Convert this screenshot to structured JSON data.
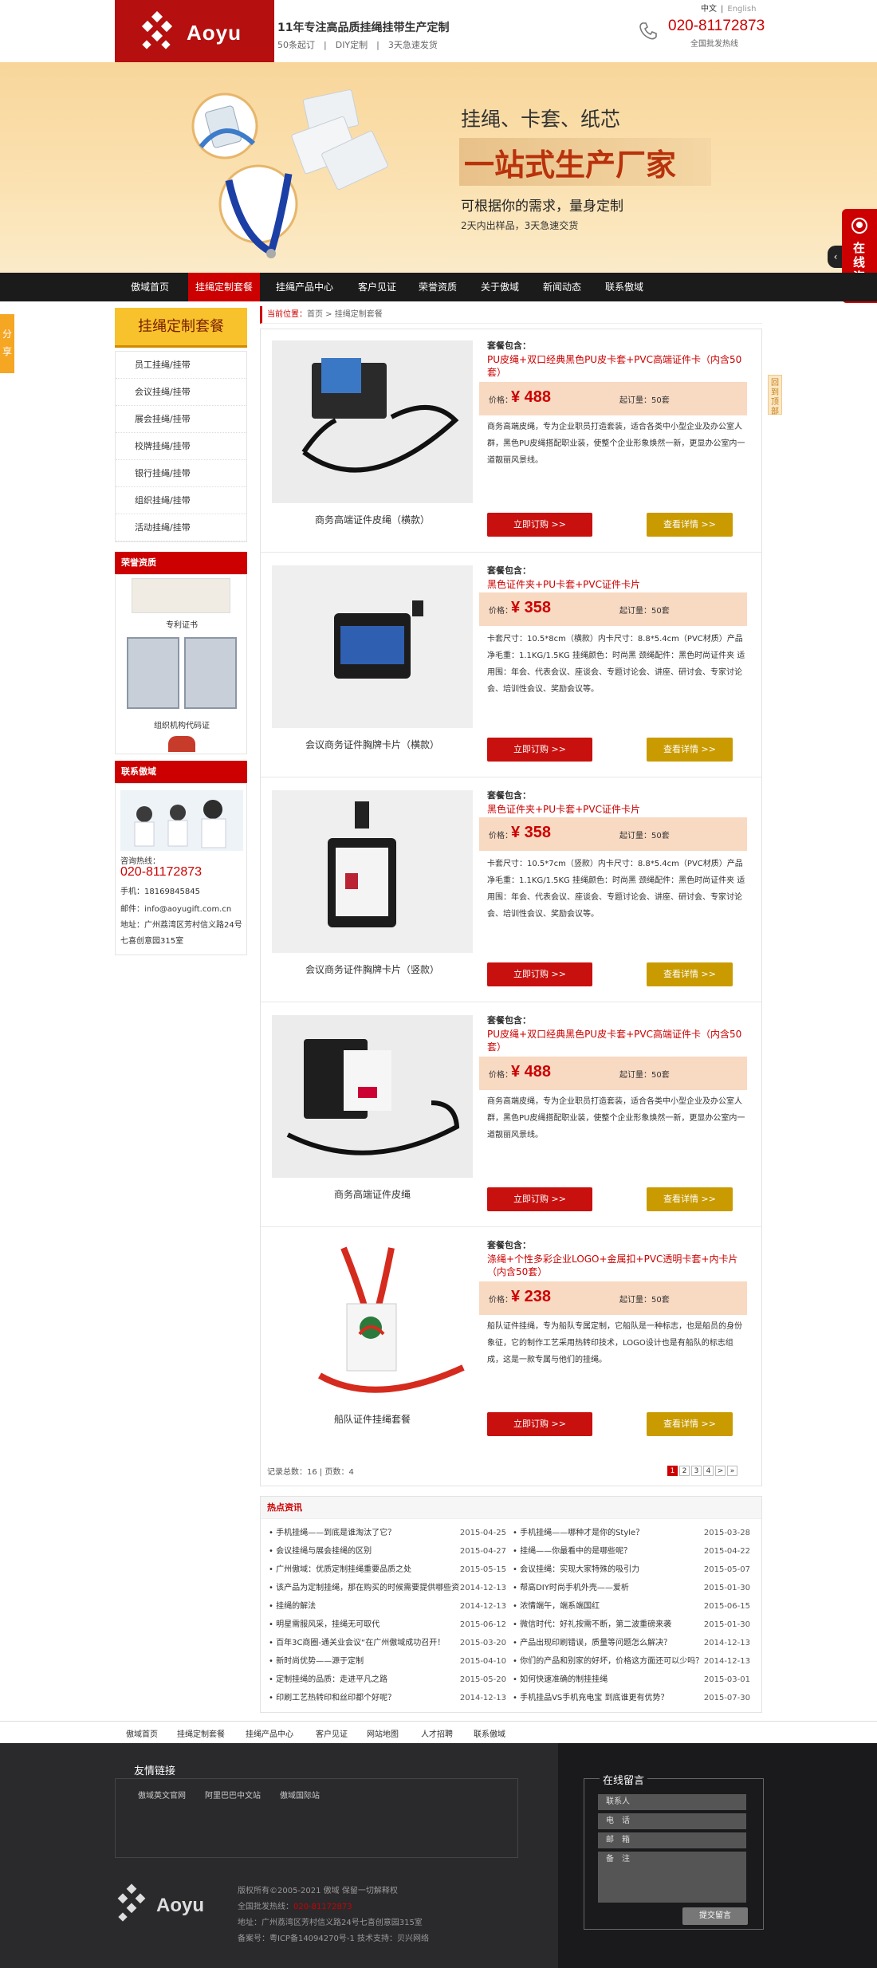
{
  "header": {
    "logo": "Aoyu",
    "slogan": "11年专注高品质挂绳挂带生产定制",
    "sub": [
      "50条起订",
      "DIY定制",
      "3天急速发货"
    ],
    "lang": [
      "中文",
      "English"
    ],
    "phone": "020-81172873",
    "phone_sub": "全国批发热线"
  },
  "banner": {
    "line1": "挂绳、卡套、纸芯",
    "line2": "一站式生产厂家",
    "line3": "可根据你的需求，量身定制",
    "line4": "2天内出样品，3天急速交货"
  },
  "nav": [
    "傲域首页",
    "挂绳定制套餐",
    "挂绳产品中心",
    "客户见证",
    "荣誉资质",
    "关于傲域",
    "新闻动态",
    "联系傲域"
  ],
  "consult": "在线咨询",
  "share": "分享",
  "backtop": "回到顶部",
  "sidebar": {
    "title": "挂绳定制套餐",
    "items": [
      "员工挂绳/挂带",
      "会议挂绳/挂带",
      "展会挂绳/挂带",
      "校牌挂绳/挂带",
      "银行挂绳/挂带",
      "组织挂绳/挂带",
      "活动挂绳/挂带"
    ],
    "honor_title": "荣誉资质",
    "honor": [
      "专利证书",
      "组织机构代码证"
    ],
    "contact_title": "联系傲域",
    "contact_label": "咨询热线：",
    "contact_phone": "020-81172873",
    "mobile": "手机：18169845845",
    "email": "邮件：info@aoyugift.com.cn",
    "addr": "地址：广州荔湾区芳村信义路24号七喜创意园315室"
  },
  "crumb": {
    "label": "当前位置：",
    "home": "首页",
    "sep": " > ",
    "page": "挂绳定制套餐"
  },
  "products": [
    {
      "pk": "套餐包含：",
      "title": "PU皮绳+双口经典黑色PU皮卡套+PVC高端证件卡（内含50套）",
      "price_label": "价格：",
      "price": "¥ 488",
      "order": "起订量：50套",
      "desc": "商务高端皮绳，专为企业职员打造套装，适合各类中小型企业及办公室人群，黑色PU皮绳搭配职业装，使整个企业形象焕然一新，更显办公室内一道靓丽风景线。",
      "name": "商务高端证件皮绳（横款）",
      "buy": "立即订购 >>",
      "detail": "查看详情 >>"
    },
    {
      "pk": "套餐包含：",
      "title": "黑色证件夹+PU卡套+PVC证件卡片",
      "price_label": "价格：",
      "price": "¥ 358",
      "order": "起订量：50套",
      "desc": "卡套尺寸：10.5*8cm（横款）内卡尺寸：8.8*5.4cm（PVC材质）产品净毛重：1.1KG/1.5KG 挂绳颜色：时尚黑 颈绳配件：黑色时尚证件夹 适用围：年会、代表会议、座谈会、专题讨论会、讲座、研讨会、专家讨论会、培训性会议、奖励会议等。",
      "name": "会议商务证件胸牌卡片（横款）",
      "buy": "立即订购 >>",
      "detail": "查看详情 >>"
    },
    {
      "pk": "套餐包含：",
      "title": "黑色证件夹+PU卡套+PVC证件卡片",
      "price_label": "价格：",
      "price": "¥ 358",
      "order": "起订量：50套",
      "desc": "卡套尺寸：10.5*7cm（竖款）内卡尺寸：8.8*5.4cm（PVC材质）产品净毛重：1.1KG/1.5KG 挂绳颜色：时尚黑 颈绳配件：黑色时尚证件夹 适用围：年会、代表会议、座谈会、专题讨论会、讲座、研讨会、专家讨论会、培训性会议、奖励会议等。",
      "name": "会议商务证件胸牌卡片（竖款）",
      "buy": "立即订购 >>",
      "detail": "查看详情 >>"
    },
    {
      "pk": "套餐包含：",
      "title": "PU皮绳+双口经典黑色PU皮卡套+PVC高端证件卡（内含50套）",
      "price_label": "价格：",
      "price": "¥ 488",
      "order": "起订量：50套",
      "desc": "商务高端皮绳，专为企业职员打造套装，适合各类中小型企业及办公室人群，黑色PU皮绳搭配职业装，使整个企业形象焕然一新，更显办公室内一道靓丽风景线。",
      "name": "商务高端证件皮绳",
      "buy": "立即订购 >>",
      "detail": "查看详情 >>"
    },
    {
      "pk": "套餐包含：",
      "title": "涤绳+个性多彩企业LOGO+金属扣+PVC透明卡套+内卡片（内含50套）",
      "price_label": "价格：",
      "price": "¥ 238",
      "order": "起订量：50套",
      "desc": "船队证件挂绳，专为船队专属定制，它船队是一种标志，也是船员的身份象征，它的制作工艺采用热转印技术，LOGO设计也是有船队的标志组成，这是一款专属与他们的挂绳。",
      "name": "船队证件挂绳套餐",
      "buy": "立即订购 >>",
      "detail": "查看详情 >>"
    }
  ],
  "pager": {
    "info": "记录总数：16 | 页数：4",
    "pages": [
      "1",
      "2",
      "3",
      "4",
      ">",
      "»"
    ]
  },
  "news": {
    "title": "热点资讯",
    "left": [
      [
        "手机挂绳——到底是谁淘汰了它？",
        "2015-04-25"
      ],
      [
        "会议挂绳与展会挂绳的区别",
        "2015-04-27"
      ],
      [
        "广州傲域：优质定制挂绳重要品质之处",
        "2015-05-15"
      ],
      [
        "该产品为定制挂绳，那在购买的时候需要提供哪些资",
        "2014-12-13"
      ],
      [
        "挂绳的解法",
        "2014-12-13"
      ],
      [
        "明星需服风采，挂绳无可取代",
        "2015-06-12"
      ],
      [
        "百年3C商圈-通关业会议“在广州傲域成功召开！",
        "2015-03-20"
      ],
      [
        "新时尚优势——源于定制",
        "2015-04-10"
      ],
      [
        "定制挂绳的品质：走进平凡之路",
        "2015-05-20"
      ],
      [
        "印刷工艺热转印和丝印都个好呢？",
        "2014-12-13"
      ]
    ],
    "right": [
      [
        "手机挂绳——哪种才是你的Style？",
        "2015-03-28"
      ],
      [
        "挂绳——你最看中的是哪些呢？",
        "2015-04-22"
      ],
      [
        "会议挂绳：实现大家特殊的吸引力",
        "2015-05-07"
      ],
      [
        "帮高DIY时尚手机外壳——爱析",
        "2015-01-30"
      ],
      [
        "浓情端午，端系端国红",
        "2015-06-15"
      ],
      [
        "微信时代：好礼按需不断，第二波重磅来袭",
        "2015-01-30"
      ],
      [
        "产品出现印刷错误，质量等问题怎么解决？",
        "2014-12-13"
      ],
      [
        "你们的产品和别家的好坏，价格这方面还可以少吗？",
        "2014-12-13"
      ],
      [
        "如何快速准确的制挂挂绳",
        "2015-03-01"
      ],
      [
        "手机挂品VS手机充电宝 到底谁更有优势？",
        "2015-07-30"
      ]
    ]
  },
  "footer": {
    "nav": [
      "傲域首页",
      "挂绳定制套餐",
      "挂绳产品中心",
      "客户见证",
      "网站地图",
      "人才招聘",
      "联系傲域"
    ],
    "friend_title": "友情链接",
    "friends": [
      "傲域英文官网",
      "阿里巴巴中文站",
      "傲域国际站"
    ],
    "logo": "Aoyu",
    "copy1": "版权所有©2005-2021 傲域 保留一切解释权",
    "copy2_label": "全国批发热线：",
    "copy2_phone": "020-81172873",
    "copy3": "地址：广州荔湾区芳村信义路24号七喜创意园315室",
    "copy4": "备案号：粤ICP备14094270号-1  技术支持：贝兴网络",
    "msg_title": "在线留言",
    "fields": [
      "联系人",
      "电　话",
      "邮　箱",
      "备　注"
    ],
    "submit": "提交留言"
  }
}
